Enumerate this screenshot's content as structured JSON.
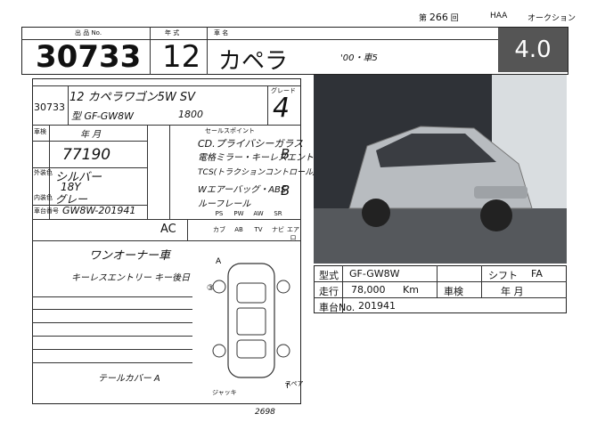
{
  "header": {
    "session_prefix": "第",
    "session_number": "266",
    "session_suffix": "回",
    "venue": "HAA",
    "auction": "オークション"
  },
  "top": {
    "lot_label": "出 品 No.",
    "lot_number": "30733",
    "year_label": "年 式",
    "year": "12",
    "name_label": "車 名",
    "name": "カペラ",
    "note": "'00・車5",
    "grade": "4.0"
  },
  "sheet": {
    "lot_number": "30733",
    "model_line": "12 カペラワゴン5W SV",
    "grade_label": "グレード",
    "model_code": "型 GF-GW8W",
    "displacement": "1800",
    "score": "4",
    "mileage_label": "車検",
    "mileage_hand": "年 月",
    "km": "77190",
    "color_label": "外装色",
    "color": "シルバー",
    "color_code": "18Y",
    "interior_label": "内装色",
    "interior": "グレー",
    "chassis_label": "車台番号",
    "chassis": "GW8W-201941",
    "sales_point_label": "セールスポイント",
    "sp_line1": "CD.プライバシーガラス",
    "sp_line2": "電格ミラー・キーレスエントリー",
    "sp_line3": "TCS(トラクションコントロール)",
    "sp_line4": "Wエアーバッグ・ABS",
    "sp_line5": "ルーフレール",
    "sp_mark_b1": "B",
    "sp_mark_b2": "B",
    "ac": "AC",
    "option_labels": [
      "PS",
      "PW",
      "AW",
      "SR",
      "カブ",
      "AB",
      "TV",
      "ナビ",
      "エアロ"
    ],
    "remarks": "ワンオーナー車",
    "remarks2": "キーレスエントリー キー後日",
    "tail": "テールカバー A",
    "jack_label": "ジャッキ",
    "spare_label": "スペア",
    "bottom_num": "2698"
  },
  "info": {
    "type_label": "型式",
    "type_value": "GF-GW8W",
    "shift_label": "シフト",
    "shift_value": "FA",
    "mileage_label": "走行",
    "mileage_value": "78,000",
    "mileage_unit": "Km",
    "inspection_label": "車検",
    "inspection_value": "年 月",
    "chassis_label": "車台No.",
    "chassis_value": "201941"
  }
}
